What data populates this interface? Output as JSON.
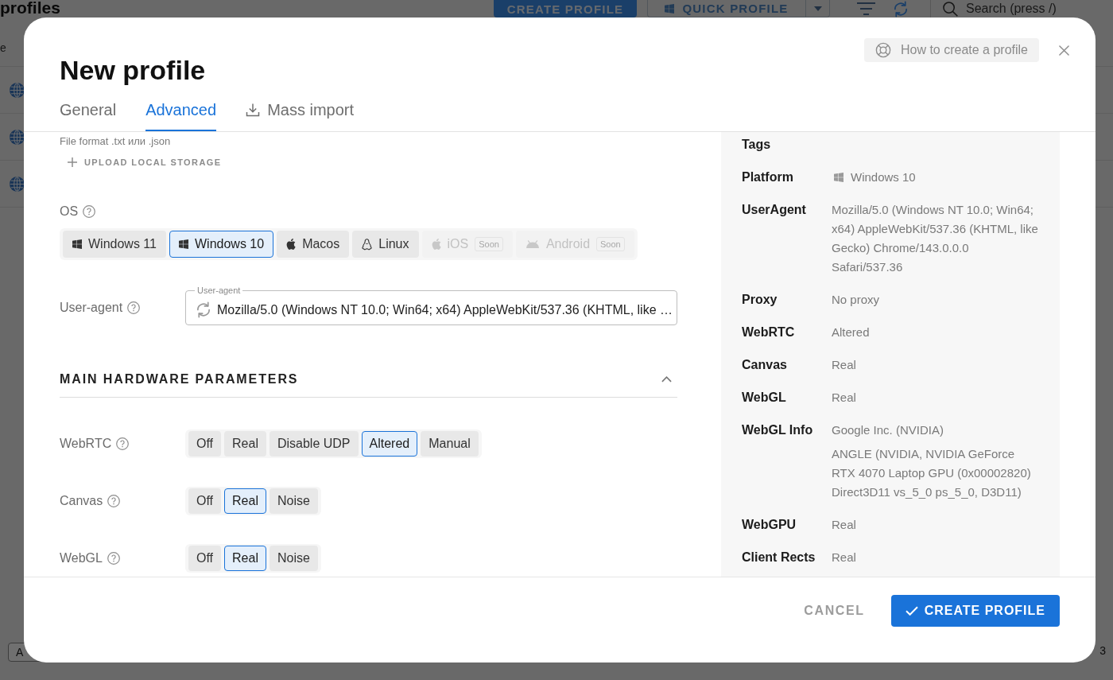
{
  "app": {
    "title": "profiles",
    "create_button": "CREATE PROFILE",
    "quick_profile_button": "QUICK PROFILE",
    "search": {
      "placeholder": "Search (press /)"
    },
    "table": {
      "column_1": "e"
    },
    "bottom_button": "A",
    "page_count": "3"
  },
  "dialog": {
    "title": "New profile",
    "help_button": "How to create a profile",
    "tabs": [
      {
        "label": "General",
        "selected": false,
        "kind": "plain"
      },
      {
        "label": "Advanced",
        "selected": true,
        "kind": "plain"
      },
      {
        "label": "Mass import",
        "selected": false,
        "kind": "import"
      }
    ],
    "file_hint": "File format .txt или .json",
    "upload_button": "UPLOAD LOCAL STORAGE",
    "os": {
      "label": "OS",
      "options": [
        {
          "label": "Windows 11",
          "kind": "windows",
          "selected": false,
          "disabled": false
        },
        {
          "label": "Windows 10",
          "kind": "windows",
          "selected": true,
          "disabled": false
        },
        {
          "label": "Macos",
          "kind": "macos",
          "selected": false,
          "disabled": false
        },
        {
          "label": "Linux",
          "kind": "linux",
          "selected": false,
          "disabled": false
        },
        {
          "label": "iOS",
          "kind": "ios",
          "selected": false,
          "disabled": true,
          "badge": "Soon"
        },
        {
          "label": "Android",
          "kind": "android",
          "selected": false,
          "disabled": true,
          "badge": "Soon"
        }
      ]
    },
    "user_agent": {
      "label": "User-agent",
      "field_label": "User-agent",
      "value": "Mozilla/5.0 (Windows NT 10.0; Win64; x64) AppleWebKit/537.36 (KHTML, like …"
    },
    "section": {
      "title": "MAIN HARDWARE PARAMETERS",
      "expanded": true
    },
    "parameters": [
      {
        "label": "WebRTC",
        "options": [
          {
            "label": "Off",
            "selected": false
          },
          {
            "label": "Real",
            "selected": false
          },
          {
            "label": "Disable UDP",
            "selected": false
          },
          {
            "label": "Altered",
            "selected": true
          },
          {
            "label": "Manual",
            "selected": false
          }
        ]
      },
      {
        "label": "Canvas",
        "options": [
          {
            "label": "Off",
            "selected": false
          },
          {
            "label": "Real",
            "selected": true
          },
          {
            "label": "Noise",
            "selected": false
          }
        ]
      },
      {
        "label": "WebGL",
        "options": [
          {
            "label": "Off",
            "selected": false
          },
          {
            "label": "Real",
            "selected": true
          },
          {
            "label": "Noise",
            "selected": false
          }
        ]
      }
    ],
    "summary": [
      {
        "label": "Tags",
        "kind": "text"
      },
      {
        "label": "Platform",
        "kind": "platform",
        "values": [
          "Windows 10"
        ]
      },
      {
        "label": "UserAgent",
        "kind": "text",
        "values": [
          "Mozilla/5.0 (Windows NT 10.0; Win64; x64) AppleWebKit/537.36 (KHTML, like Gecko) Chrome/143.0.0.0 Safari/537.36"
        ]
      },
      {
        "label": "Proxy",
        "kind": "text",
        "values": [
          "No proxy"
        ]
      },
      {
        "label": "WebRTC",
        "kind": "text",
        "values": [
          "Altered"
        ]
      },
      {
        "label": "Canvas",
        "kind": "text",
        "values": [
          "Real"
        ]
      },
      {
        "label": "WebGL",
        "kind": "text",
        "values": [
          "Real"
        ]
      },
      {
        "label": "WebGL Info",
        "kind": "text",
        "values": [
          "Google Inc. (NVIDIA)",
          "ANGLE (NVIDIA, NVIDIA GeForce RTX 4070 Laptop GPU (0x00002820) Direct3D11 vs_5_0 ps_5_0, D3D11)"
        ]
      },
      {
        "label": "WebGPU",
        "kind": "text",
        "values": [
          "Real"
        ]
      },
      {
        "label": "Client Rects",
        "kind": "text",
        "values": [
          "Real"
        ]
      }
    ],
    "cancel_button": "CANCEL",
    "create_button": "CREATE PROFILE"
  }
}
